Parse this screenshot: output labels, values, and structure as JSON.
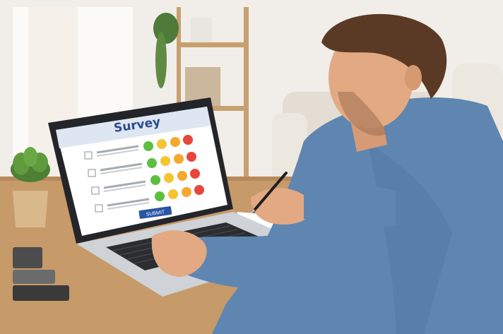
{
  "survey": {
    "title": "Survey",
    "submit_label": "SUBMIT",
    "question_count": 4,
    "rating_scale": [
      "very-satisfied",
      "satisfied",
      "neutral",
      "dissatisfied"
    ]
  },
  "colors": {
    "wall": "#f1ede8",
    "desk": "#c79a6a",
    "shirt": "#5f86b1",
    "skin": "#e2a982",
    "hair": "#5a3a24",
    "laptop_body": "#d3d5d9",
    "screen_header": "#dde6f1",
    "survey_title": "#2a4a8e",
    "submit_button": "#2a55a5",
    "rating_green": "#5cbf3f",
    "rating_yellow": "#f5c431",
    "rating_orange": "#f5a72e",
    "rating_red": "#e8453c"
  },
  "icons": [
    "plant-icon",
    "pen-icon",
    "checkbox-icon",
    "smiley-face-icon"
  ]
}
